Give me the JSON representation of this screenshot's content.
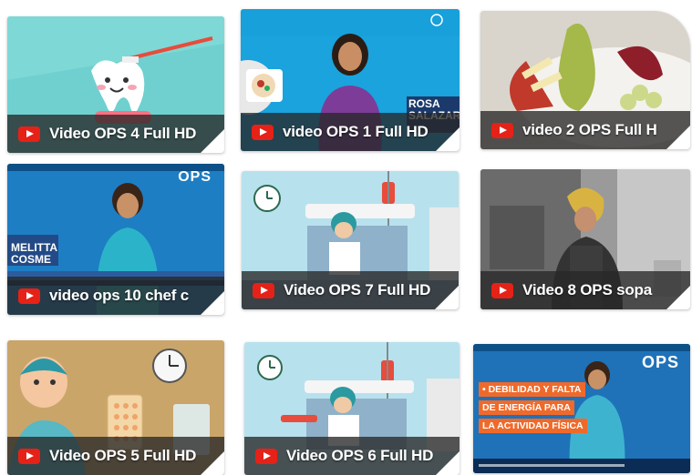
{
  "videos": [
    {
      "title": "Video OPS 4 Full HD"
    },
    {
      "title": "video OPS 1 Full HD",
      "lower_third": "ROSA\nSALAZAR"
    },
    {
      "title": "video 2 OPS Full H"
    },
    {
      "title": "video ops 10 chef c",
      "logo": "OPS",
      "lower_third": "MELITTA\nCOSME"
    },
    {
      "title": "Video OPS 7 Full HD"
    },
    {
      "title": "Video 8 OPS sopa"
    },
    {
      "title": "Video OPS 5 Full HD"
    },
    {
      "title": "Video OPS 6 Full HD"
    },
    {
      "logo": "OPS",
      "banner": [
        "• DEBILIDAD Y FALTA",
        "DE ENERGÍA PARA",
        "LA ACTIVIDAD FÍSICA"
      ]
    }
  ],
  "colors": {
    "youtube_red": "#e62117",
    "caption_bar": "#282828",
    "ops_blue": "#1f72b8",
    "banner_orange": "#ef6a2a"
  },
  "icons": [
    "youtube-play-icon",
    "clock-icon",
    "iv-drip-icon"
  ]
}
